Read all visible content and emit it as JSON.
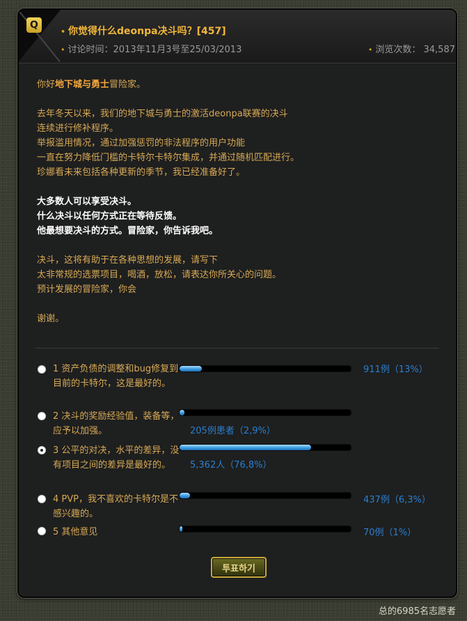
{
  "header": {
    "q_badge": "Q",
    "bullet": "•",
    "title": "你觉得什么deonpa决斗吗？[457]",
    "meta_label": "讨论时间：",
    "meta_date": "2013年11月3号至25/03/2013",
    "views_label": "浏览次数：",
    "views_count": "34,587"
  },
  "body": {
    "greeting_pre": "你好",
    "greeting_highlight": "地下城与勇士",
    "greeting_post": "冒险家。",
    "para1": [
      "去年冬天以来，我们的地下城与勇士的激活deonpa联赛的决斗",
      "连续进行修补程序。",
      "举报滥用情况，通过加强惩罚的非法程序的用户功能",
      "一直在努力降低门槛的卡特尔卡特尔集成，并通过随机匹配进行。",
      "珍娜看未来包括各种更新的季节，我已经准备好了。"
    ],
    "para2": [
      "大多数人可以享受决斗。",
      "什么决斗以任何方式正在等待反馈。",
      "他最想要决斗的方式。冒险家，你告诉我吧。"
    ],
    "para3": [
      "决斗，这将有助于在各种思想的发展，请写下",
      "太非常规的选票项目，喝酒，放松，请表达你所关心的问题。",
      "预计发展的冒险家，你会"
    ],
    "thanks": "谢谢。"
  },
  "poll": {
    "options": [
      {
        "label": "1 资产负债的调整和bug修复到目前的卡特尔，这是最好的。",
        "percent": 13,
        "result": "911例（13%）",
        "checked": false
      },
      {
        "label": "2 决斗的奖励经验值，装备等，应予以加强。",
        "percent": 2.9,
        "result": "205例患者（2,9%）",
        "checked": false
      },
      {
        "label": "3 公平的对决，水平的差异，没有项目之间的差异是最好的。",
        "percent": 76.8,
        "result": "5,362人（76,8%）",
        "checked": true
      },
      {
        "label": "4 PVP，我不喜欢的卡特尔是不感兴趣的。",
        "percent": 6.3,
        "result": "437例（6,3%）",
        "checked": false
      },
      {
        "label": "5 其他意见",
        "percent": 1,
        "result": "70例（1%）",
        "checked": false
      }
    ],
    "vote_button": "투표하기",
    "bar_color": "#3e9de0"
  },
  "footer": {
    "total": "总的6985名志愿者"
  }
}
